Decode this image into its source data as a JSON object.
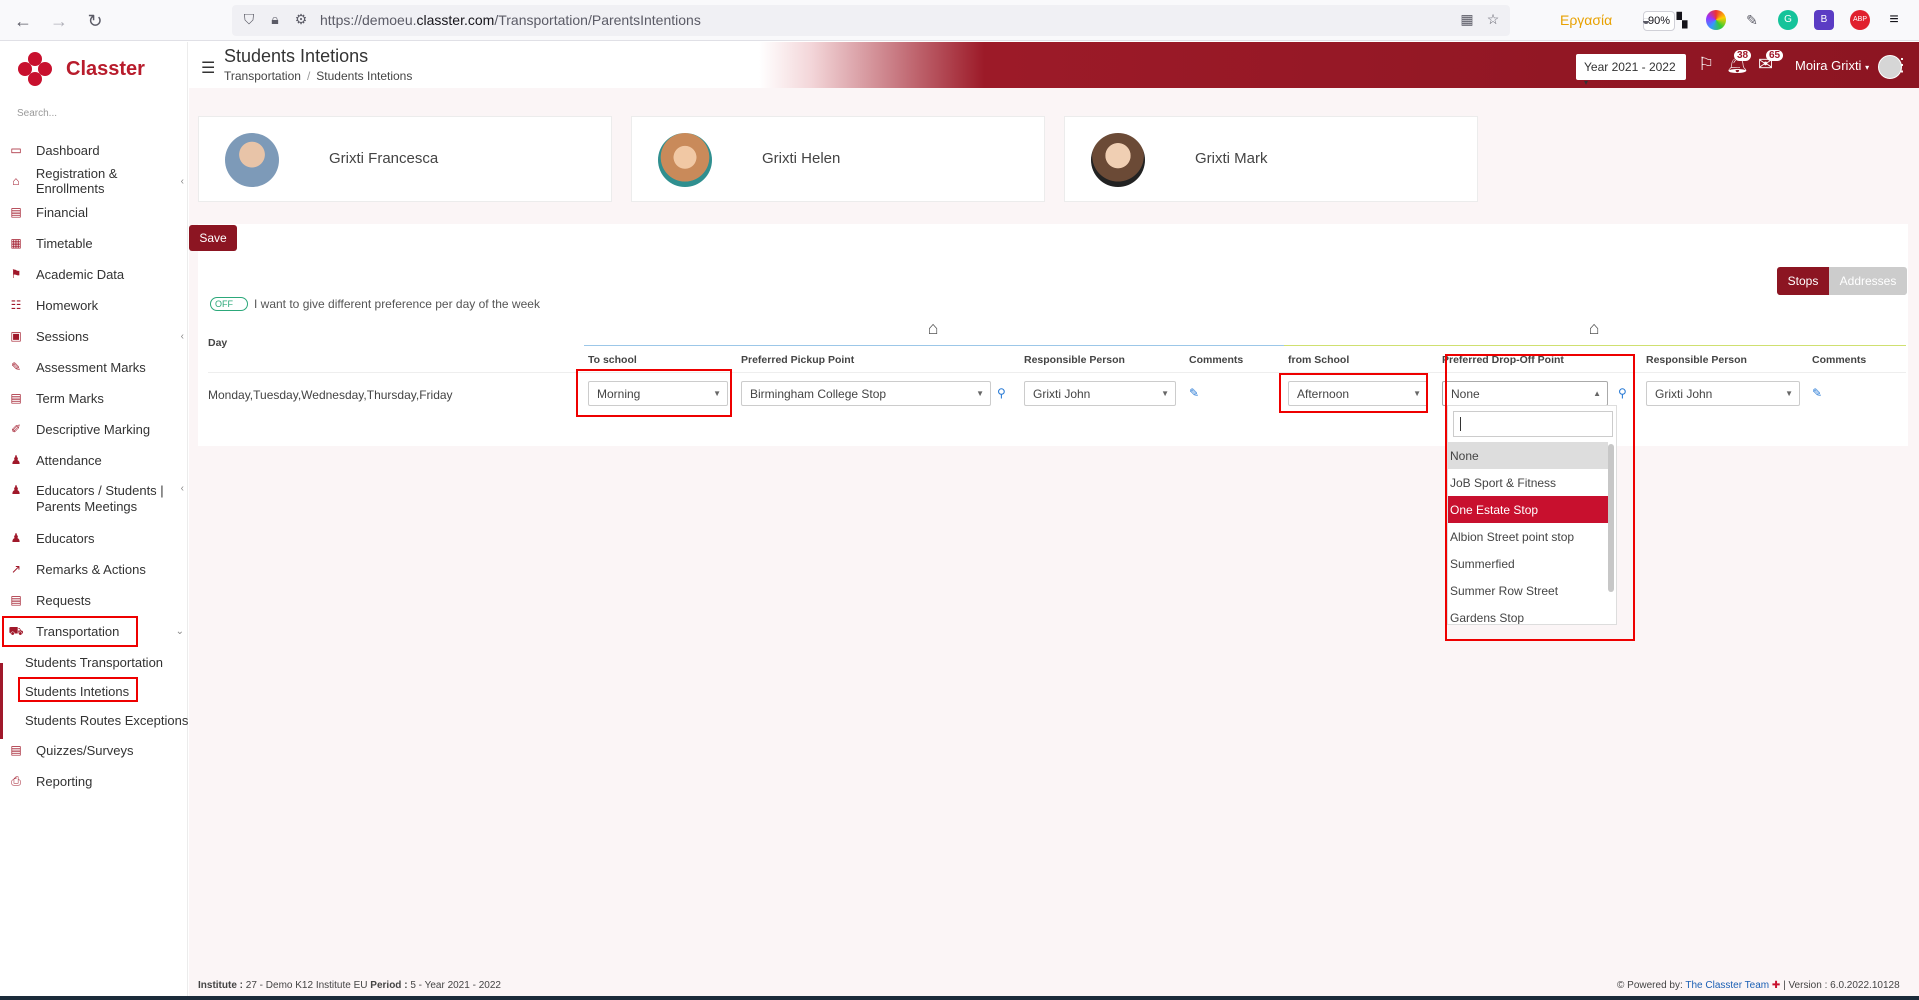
{
  "browser": {
    "url_prefix": "https://demoeu.",
    "url_domain": "classter.com",
    "url_path": "/Transportation/ParentsIntentions",
    "work_label": "Εργασία",
    "zoom": "90%",
    "abp_label": "ABP"
  },
  "app": {
    "brand": "Classter",
    "search_placeholder": "Search...",
    "page_title": "Students Intetions",
    "breadcrumb": [
      "Transportation",
      "Students Intetions"
    ],
    "breadcrumb_sep": "/",
    "year": "Year 2021 - 2022",
    "notifications_count": "38",
    "messages_count": "65",
    "user_name": "Moira Grixti"
  },
  "sidebar": {
    "items": [
      {
        "label": "Dashboard",
        "icon": "laptop-icon"
      },
      {
        "label": "Registration & Enrollments",
        "icon": "institution-icon"
      },
      {
        "label": "Financial",
        "icon": "money-icon"
      },
      {
        "label": "Timetable",
        "icon": "calendar-icon"
      },
      {
        "label": "Academic Data",
        "icon": "academic-icon"
      },
      {
        "label": "Homework",
        "icon": "list-icon"
      },
      {
        "label": "Sessions",
        "icon": "sessions-icon"
      },
      {
        "label": "Assessment Marks",
        "icon": "edit-icon"
      },
      {
        "label": "Term Marks",
        "icon": "term-icon"
      },
      {
        "label": "Descriptive Marking",
        "icon": "pencil-icon"
      },
      {
        "label": "Attendance",
        "icon": "user-check-icon"
      },
      {
        "label": "Educators / Students | Parents Meetings",
        "icon": "meeting-icon"
      },
      {
        "label": "Educators",
        "icon": "educators-icon"
      },
      {
        "label": "Remarks & Actions",
        "icon": "chart-icon"
      },
      {
        "label": "Requests",
        "icon": "requests-icon"
      },
      {
        "label": "Transportation",
        "icon": "bus-icon"
      },
      {
        "label": "Quizzes/Surveys",
        "icon": "quiz-icon"
      },
      {
        "label": "Reporting",
        "icon": "print-icon"
      }
    ],
    "sub_items": [
      "Students Transportation",
      "Students Intetions",
      "Students Routes Exceptions"
    ]
  },
  "students": [
    {
      "name": "Grixti Francesca",
      "avatar_color": "#7d9ab8"
    },
    {
      "name": "Grixti Helen",
      "avatar_color": "#c98a5a"
    },
    {
      "name": "Grixti Mark",
      "avatar_color": "#6b4a36"
    }
  ],
  "form": {
    "save_label": "Save",
    "toggle_label": "OFF",
    "toggle_text": "I want to give different preference per day of the week",
    "stops_label": "Stops",
    "addresses_label": "Addresses",
    "day_header": "Day",
    "headers": {
      "to_school": "To school",
      "pickup": "Preferred Pickup Point",
      "responsible1": "Responsible Person",
      "comments1": "Comments",
      "from_school": "from School",
      "dropoff": "Preferred Drop-Off Point",
      "responsible2": "Responsible Person",
      "comments2": "Comments"
    },
    "row": {
      "days": "Monday,Tuesday,Wednesday,Thursday,Friday",
      "to_school": "Morning",
      "pickup": "Birmingham College Stop",
      "responsible1": "Grixti John",
      "from_school": "Afternoon",
      "dropoff": "None",
      "responsible2": "Grixti John"
    }
  },
  "dropdown": {
    "options": [
      "None",
      "JoB Sport & Fitness",
      "One Estate Stop",
      "Albion Street point stop",
      "Summerfied",
      "Summer Row Street",
      "Gardens Stop"
    ],
    "selected": "None",
    "highlighted": "One Estate Stop"
  },
  "footer": {
    "institute_label": "Institute :",
    "institute_value": "27 - Demo K12 Institute EU",
    "period_label": "Period :",
    "period_value": "5 - Year 2021 - 2022",
    "powered_by": "Powered by:",
    "team": "The Classter Team",
    "version": "| Version : 6.0.2022.10128"
  },
  "colors": {
    "brand": "#8c1522",
    "accent_red": "#c8102e",
    "highlight": "#c8102e",
    "link": "#2a7bd5"
  }
}
